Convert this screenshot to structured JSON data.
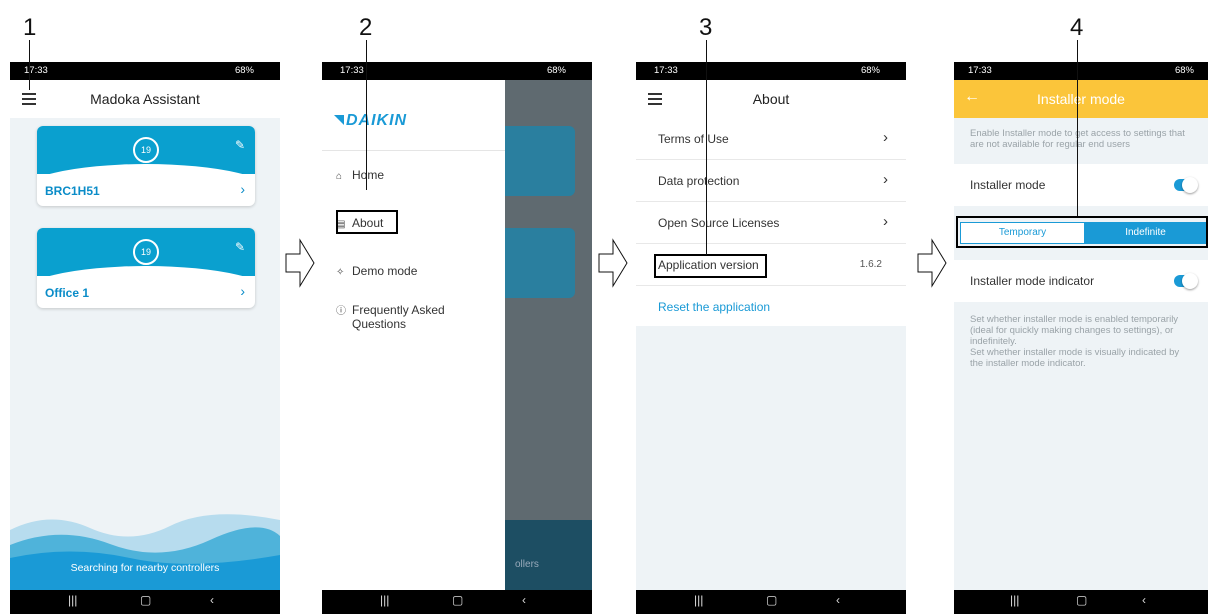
{
  "steps": [
    "1",
    "2",
    "3",
    "4"
  ],
  "status_bar": {
    "time": "17:33",
    "right": "68%"
  },
  "screen1": {
    "title": "Madoka Assistant",
    "cards": [
      {
        "temp": "19",
        "name": "BRC1H51"
      },
      {
        "temp": "19",
        "name": "Office 1"
      }
    ],
    "searching": "Searching for nearby controllers"
  },
  "screen2": {
    "logo": "DAIKIN",
    "menu": [
      "Home",
      "About",
      "Demo mode",
      "Frequently Asked",
      "Questions"
    ],
    "behind_text": "ollers"
  },
  "screen3": {
    "title": "About",
    "rows": [
      "Terms of Use",
      "Data protection",
      "Open Source Licenses",
      "Application version"
    ],
    "version": "1.6.2",
    "reset": "Reset the application"
  },
  "screen4": {
    "title": "Installer mode",
    "hint_top": "Enable Installer mode to get access to settings that are not available for regular end users",
    "installer_mode": "Installer mode",
    "seg_temporary": "Temporary",
    "seg_indefinite": "Indefinite",
    "indicator": "Installer mode indicator",
    "hint_bottom_1": "Set whether installer mode is enabled temporarily (ideal for quickly making changes to settings), or indefinitely.",
    "hint_bottom_2": "Set whether installer mode is visually indicated by the installer mode indicator."
  },
  "colors": {
    "accent_blue": "#0aa0cf",
    "installer_yellow": "#fbc53a"
  }
}
